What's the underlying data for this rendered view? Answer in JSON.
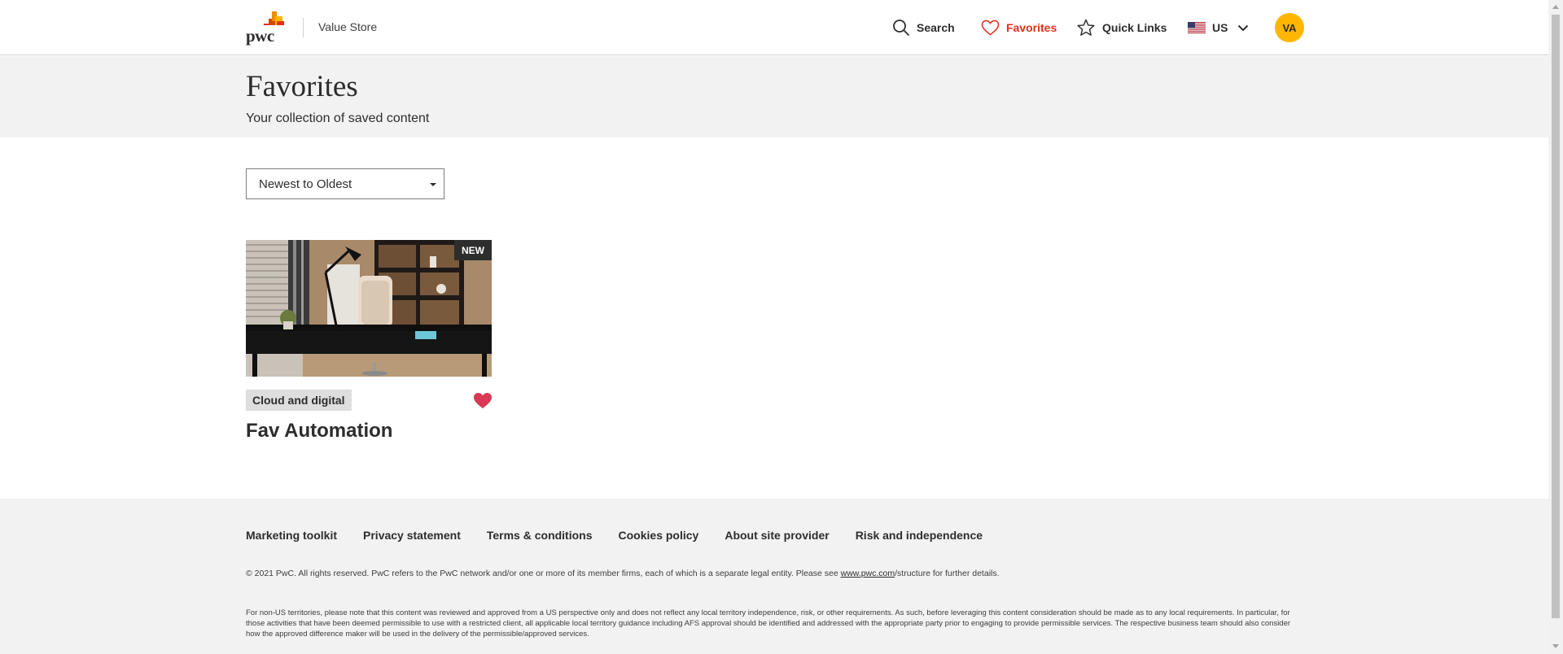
{
  "header": {
    "logo_text": "pwc",
    "store_name": "Value Store",
    "nav": {
      "search": "Search",
      "favorites": "Favorites",
      "quick_links": "Quick Links",
      "country": "US"
    },
    "avatar_initials": "VA"
  },
  "hero": {
    "title": "Favorites",
    "subtitle": "Your collection of saved content"
  },
  "sort": {
    "selected": "Newest to Oldest"
  },
  "cards": [
    {
      "badge": "NEW",
      "tag": "Cloud and digital",
      "title": "Fav Automation"
    }
  ],
  "footer": {
    "links": [
      "Marketing toolkit",
      "Privacy statement",
      "Terms & conditions",
      "Cookies policy",
      "About site provider",
      "Risk and independence"
    ],
    "copyright_before": "© 2021 PwC. All rights reserved. PwC refers to the PwC network and/or one or more of its member firms, each of which is a separate legal entity. Please see ",
    "copyright_link": "www.pwc.com",
    "copyright_after": "/structure for further details.",
    "disclaimer": "For non-US territories, please note that this content was reviewed and approved from a US perspective only and does not reflect any local territory independence, risk, or other requirements. As such, before leveraging this content consideration should be made as to any local requirements. In particular, for those activities that have been deemed permissible to use with a restricted client, all applicable local territory guidance including AFS approval should be identified and addressed with the appropriate party prior to engaging to provide permissible services. The respective business team should also consider how the approved difference maker will be used in the delivery of the permissible/approved services."
  },
  "colors": {
    "brand_red": "#e0301e",
    "brand_orange": "#eb8c00",
    "brand_yellow": "#ffb600",
    "heart_pink": "#d93954"
  }
}
